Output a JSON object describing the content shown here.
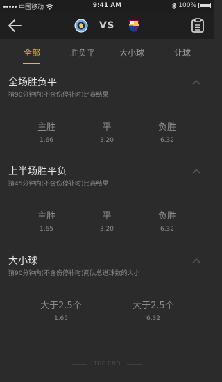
{
  "status": {
    "carrier": "中国移动",
    "time": "9:41 AM",
    "battery": "100%"
  },
  "header": {
    "vs": "VS",
    "home_logo_icon": "man-city-crest-icon",
    "away_logo_icon": "barcelona-crest-icon"
  },
  "tabs": [
    {
      "label": "全部",
      "active": true
    },
    {
      "label": "胜负平",
      "active": false
    },
    {
      "label": "大小球",
      "active": false
    },
    {
      "label": "让球",
      "active": false
    }
  ],
  "sections": [
    {
      "title": "全场胜负平",
      "subtitle": "猜90分钟内(不含伤停补时)比赛结果",
      "options": [
        {
          "label": "主胜",
          "odds": "1.66"
        },
        {
          "label": "平",
          "odds": "3.20"
        },
        {
          "label": "负胜",
          "odds": "6.32"
        }
      ]
    },
    {
      "title": "上半场胜平负",
      "subtitle": "猜45分钟内(不含伤停补时)比赛结果",
      "options": [
        {
          "label": "主胜",
          "odds": "1.65"
        },
        {
          "label": "平",
          "odds": "3.20"
        },
        {
          "label": "负胜",
          "odds": "6.32"
        }
      ]
    },
    {
      "title": "大小球",
      "subtitle": "猜90分钟内(不含伤停补时)两队总进球数的大小",
      "options": [
        {
          "label": "大于2.5个",
          "odds": "1.65"
        },
        {
          "label": "大于2.5个",
          "odds": "6.32"
        }
      ]
    }
  ],
  "footer": {
    "end_text": "THE END"
  },
  "colors": {
    "accent": "#e6b63c",
    "background": "#2b2b2b",
    "nav": "#1f1f1f"
  }
}
